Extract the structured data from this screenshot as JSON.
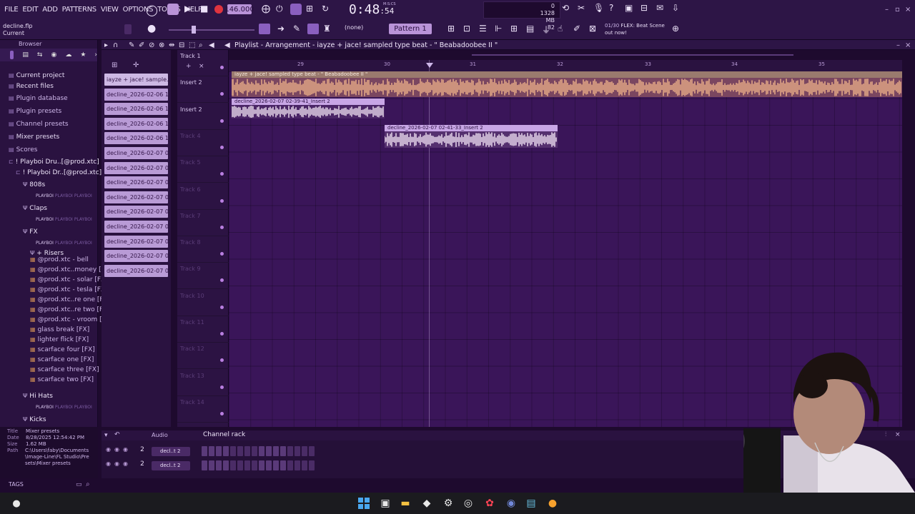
{
  "menu": [
    "FILE",
    "EDIT",
    "ADD",
    "PATTERNS",
    "VIEW",
    "OPTIONS",
    "TOOLS",
    "HELP"
  ],
  "project": {
    "file": "decline.flp",
    "hint": "Current"
  },
  "transport": {
    "tempo": "146.000",
    "time": "0:48",
    "time_sub": ":54",
    "time_unit": "M:S:CS"
  },
  "toolbar": {
    "snap": "(none)",
    "pattern": "Pattern 1",
    "cpu_mem": "1328 MB",
    "cpu_num": "82",
    "cpu_top": "0"
  },
  "news": {
    "counter": "01/30",
    "line1": "FLEX: Beat Scene",
    "line2": "out now!"
  },
  "browser": {
    "header": "Browser",
    "items": [
      {
        "label": "Current project",
        "kind": "sel"
      },
      {
        "label": "Recent files",
        "kind": "sel"
      },
      {
        "label": "Plugin database",
        "kind": "item"
      },
      {
        "label": "Plugin presets",
        "kind": "item"
      },
      {
        "label": "Channel presets",
        "kind": "item"
      },
      {
        "label": "Mixer presets",
        "kind": "sel"
      },
      {
        "label": "Scores",
        "kind": "item"
      },
      {
        "label": "! Playboi Dru..[@prod.xtc]",
        "kind": "folder"
      },
      {
        "label": "! Playboi Dr..[@prod.xtc]",
        "kind": "folder"
      }
    ],
    "subfolders": [
      "808s",
      "Claps",
      "FX",
      "+ Risers",
      "Hi Hats",
      "Kicks"
    ],
    "tag": "PLAYBOI",
    "fx_files": [
      "@prod.xtc - bell",
      "@prod.xtc..money [FX]",
      "@prod.xtc - solar [FX]",
      "@prod.xtc - tesla [FX]",
      "@prod.xtc..re one [FX]",
      "@prod.xtc..re two [FX]",
      "@prod.xtc - vroom [FX]",
      "glass break [FX]",
      "lighter flick [FX]",
      "scarface four [FX]",
      "scarface one [FX]",
      "scarface three [FX]",
      "scarface two [FX]"
    ],
    "info": {
      "title": "Mixer presets",
      "date": "8/28/2025 12:54:42 PM",
      "size": "1.62 MB",
      "path": "C:\\Users\\faby\\Documents\\Image-Line\\FL Studio\\Presets\\Mixer presets",
      "tags_label": "TAGS"
    }
  },
  "playlist": {
    "title": "Playlist - Arrangement - iayze + jace! sampled type beat - \" Beabadoobee II \"",
    "clip_list": [
      "iayze + jace! sample...",
      "decline_2026-02-06 14-...",
      "decline_2026-02-06 14-...",
      "decline_2026-02-06 14-...",
      "decline_2026-02-06 18-...",
      "decline_2026-02-07 02-...",
      "decline_2026-02-07 02-...",
      "decline_2026-02-07 02-...",
      "decline_2026-02-07 02-...",
      "decline_2026-02-07 02-...",
      "decline_2026-02-07 02-...",
      "decline_2026-02-07 02-...",
      "decline_2026-02-07 02-...",
      "decline_2026-02-07 02-..."
    ],
    "tracks": [
      "Track 1",
      "Insert 2",
      "Insert 2",
      "Track 4",
      "Track 5",
      "Track 6",
      "Track 7",
      "Track 8",
      "Track 9",
      "Track 10",
      "Track 11",
      "Track 12",
      "Track 13",
      "Track 14"
    ],
    "ruler": [
      "29",
      "30",
      "31",
      "32",
      "33",
      "34",
      "35"
    ],
    "clips": [
      {
        "label": "iayze + jace! sampled type beat - \" Beabadoobee II \""
      },
      {
        "label": "decline_2026-02-07 02-39-41_Insert 2"
      },
      {
        "label": "decline_2026-02-07 02-41-33_Insert 2"
      }
    ]
  },
  "channel_rack": {
    "title": "Channel rack",
    "audio": "Audio",
    "rows": [
      {
        "num": "2",
        "name": "decl..t 2"
      },
      {
        "num": "2",
        "name": "decl..t 2"
      }
    ]
  },
  "colors": {
    "accent": "#b993d8",
    "background": "#3a1559",
    "record": "#e0343f"
  }
}
